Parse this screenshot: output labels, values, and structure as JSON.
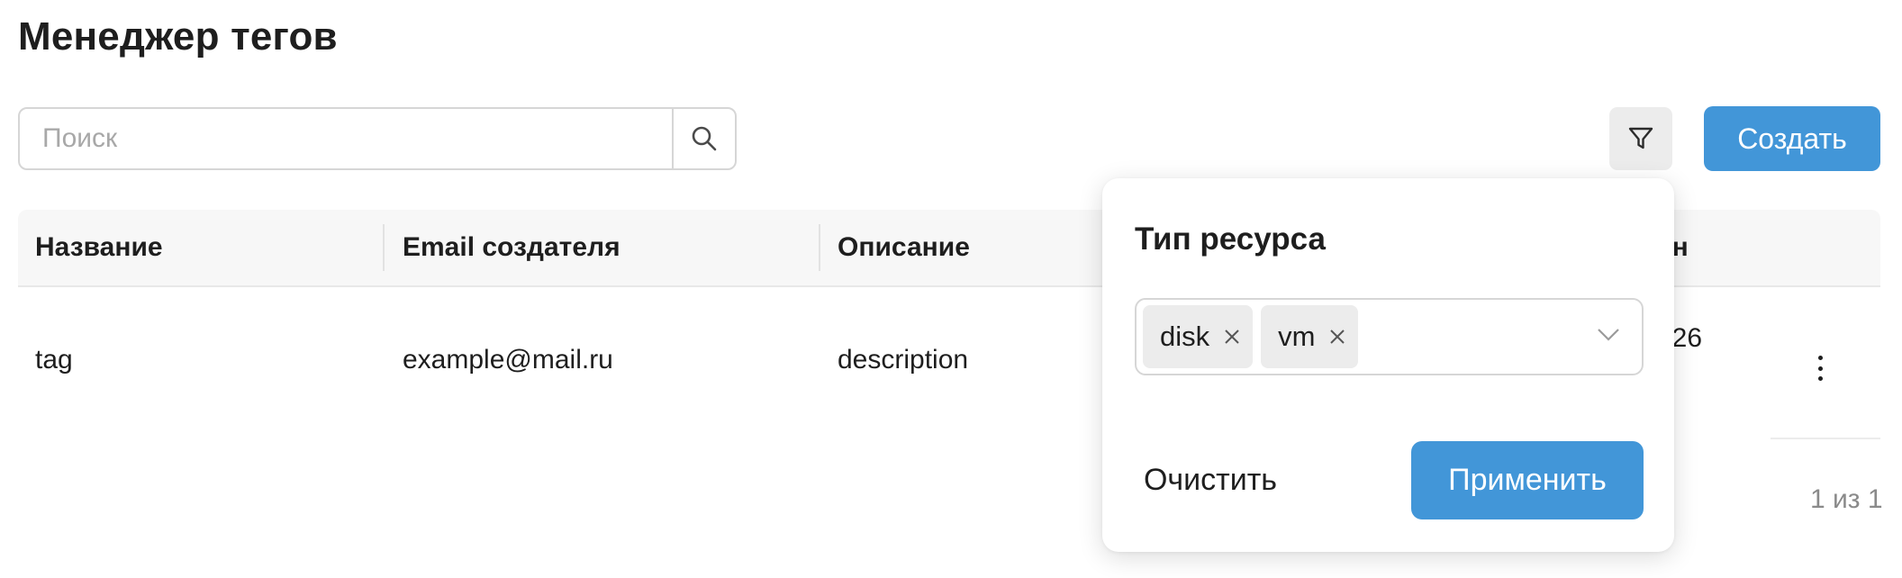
{
  "page": {
    "title": "Менеджер тегов"
  },
  "toolbar": {
    "search_placeholder": "Поиск",
    "search_value": "",
    "create_label": "Создать"
  },
  "table": {
    "columns": [
      {
        "label": "Название"
      },
      {
        "label": "Email создателя"
      },
      {
        "label": "Описание"
      },
      {
        "label": "ён"
      }
    ],
    "rows": [
      {
        "name": "tag",
        "email": "example@mail.ru",
        "description": "description",
        "date_fragment": "026"
      }
    ]
  },
  "pagination": {
    "text": "1 из 1"
  },
  "filter_popover": {
    "title": "Тип ресурса",
    "selected": [
      "disk",
      "vm"
    ],
    "clear_label": "Очистить",
    "apply_label": "Применить"
  },
  "colors": {
    "accent": "#4296d8",
    "header_bg": "#f7f7f7",
    "chip_bg": "#ececec",
    "border": "#d6d6d6"
  },
  "icons": {
    "search": "search-icon",
    "filter": "filter-icon",
    "more": "more-vertical-icon",
    "chip_remove": "close-icon",
    "dropdown": "chevron-down-icon"
  }
}
